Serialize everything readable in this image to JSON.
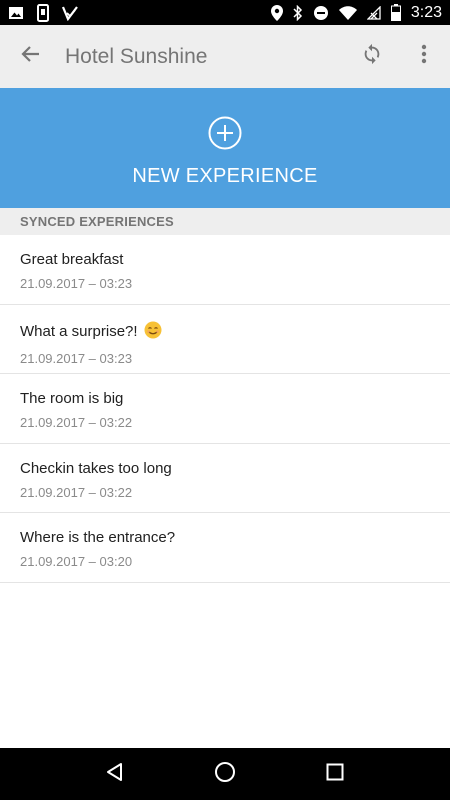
{
  "status_bar": {
    "time": "3:23",
    "left_icons": [
      "image-icon",
      "phone-icon",
      "check-icon"
    ],
    "right_icons": [
      "location-icon",
      "bluetooth-icon",
      "do-not-disturb-icon",
      "wifi-icon",
      "no-signal-icon",
      "battery-icon"
    ]
  },
  "app_bar": {
    "title": "Hotel Sunshine",
    "back_icon": "arrow-back-icon",
    "sync_icon": "sync-icon",
    "menu_icon": "more-vert-icon",
    "background": "#eeeeee"
  },
  "hero": {
    "label": "NEW EXPERIENCE",
    "icon": "add-circle-icon",
    "background": "#4fa0df"
  },
  "section": {
    "title": "SYNCED EXPERIENCES"
  },
  "experiences": [
    {
      "title": "Great breakfast",
      "date": "21.09.2017 – 03:23"
    },
    {
      "title": "What a surprise?!",
      "date": "21.09.2017 – 03:23",
      "emoji": "smiling-face-icon"
    },
    {
      "title": "The room is big",
      "date": "21.09.2017 – 03:22"
    },
    {
      "title": "Checkin takes too long",
      "date": "21.09.2017 – 03:22"
    },
    {
      "title": "Where is the entrance?",
      "date": "21.09.2017 – 03:20"
    }
  ],
  "nav_bar": {
    "icons": [
      "back-triangle-icon",
      "home-circle-icon",
      "recents-square-icon"
    ]
  }
}
